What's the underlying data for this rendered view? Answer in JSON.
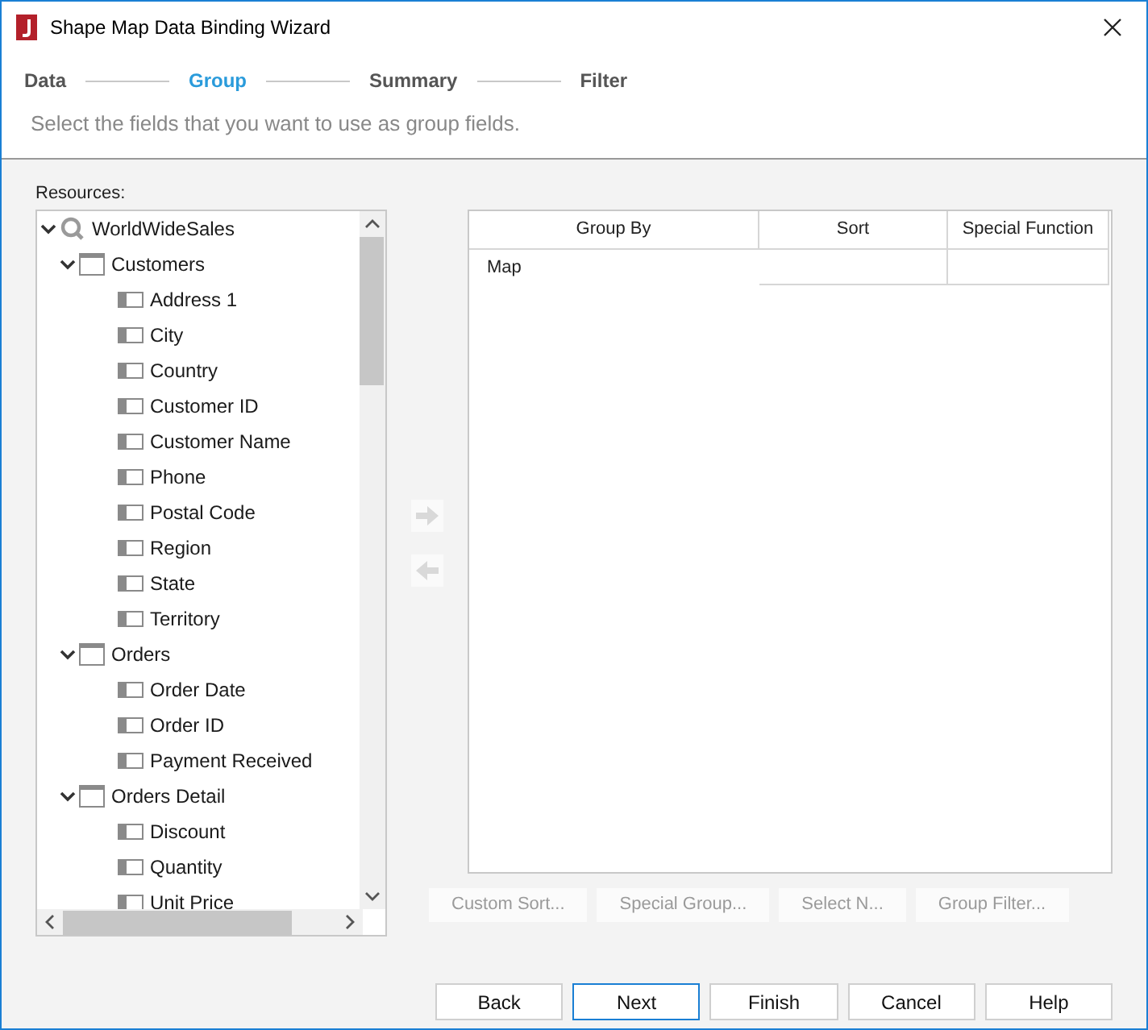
{
  "window": {
    "title": "Shape Map Data Binding Wizard"
  },
  "steps": [
    {
      "label": "Data",
      "selected": false
    },
    {
      "label": "Group",
      "selected": true
    },
    {
      "label": "Summary",
      "selected": false
    },
    {
      "label": "Filter",
      "selected": false
    }
  ],
  "instruction": "Select the fields that you want to use as group fields.",
  "resources": {
    "label": "Resources:",
    "tree": [
      {
        "label": "WorldWideSales",
        "kind": "database",
        "expanded": true,
        "children": [
          {
            "label": "Customers",
            "kind": "table",
            "expanded": true,
            "children": [
              {
                "label": "Address 1",
                "kind": "field"
              },
              {
                "label": "City",
                "kind": "field"
              },
              {
                "label": "Country",
                "kind": "field"
              },
              {
                "label": "Customer ID",
                "kind": "field"
              },
              {
                "label": "Customer Name",
                "kind": "field"
              },
              {
                "label": "Phone",
                "kind": "field"
              },
              {
                "label": "Postal Code",
                "kind": "field"
              },
              {
                "label": "Region",
                "kind": "field"
              },
              {
                "label": "State",
                "kind": "field"
              },
              {
                "label": "Territory",
                "kind": "field"
              }
            ]
          },
          {
            "label": "Orders",
            "kind": "table",
            "expanded": true,
            "children": [
              {
                "label": "Order Date",
                "kind": "field"
              },
              {
                "label": "Order ID",
                "kind": "field"
              },
              {
                "label": "Payment Received",
                "kind": "field"
              }
            ]
          },
          {
            "label": "Orders Detail",
            "kind": "table",
            "expanded": true,
            "children": [
              {
                "label": "Discount",
                "kind": "field"
              },
              {
                "label": "Quantity",
                "kind": "field"
              },
              {
                "label": "Unit Price",
                "kind": "field"
              }
            ]
          }
        ]
      }
    ]
  },
  "move_buttons": [
    {
      "kind": "add",
      "disabled": true
    },
    {
      "kind": "remove",
      "disabled": true
    }
  ],
  "table": {
    "columns": [
      "Group By",
      "Sort",
      "Special Function"
    ],
    "rows": [
      {
        "group_by": "Map",
        "sort": "",
        "special_function": ""
      }
    ]
  },
  "group_buttons": [
    {
      "label": "Custom Sort...",
      "disabled": true
    },
    {
      "label": "Special Group...",
      "disabled": true
    },
    {
      "label": "Select N...",
      "disabled": true
    },
    {
      "label": "Group Filter...",
      "disabled": true
    }
  ],
  "footer_buttons": [
    {
      "label": "Back",
      "default": false
    },
    {
      "label": "Next",
      "default": true
    },
    {
      "label": "Finish",
      "default": false
    },
    {
      "label": "Cancel",
      "default": false
    },
    {
      "label": "Help",
      "default": false
    }
  ]
}
